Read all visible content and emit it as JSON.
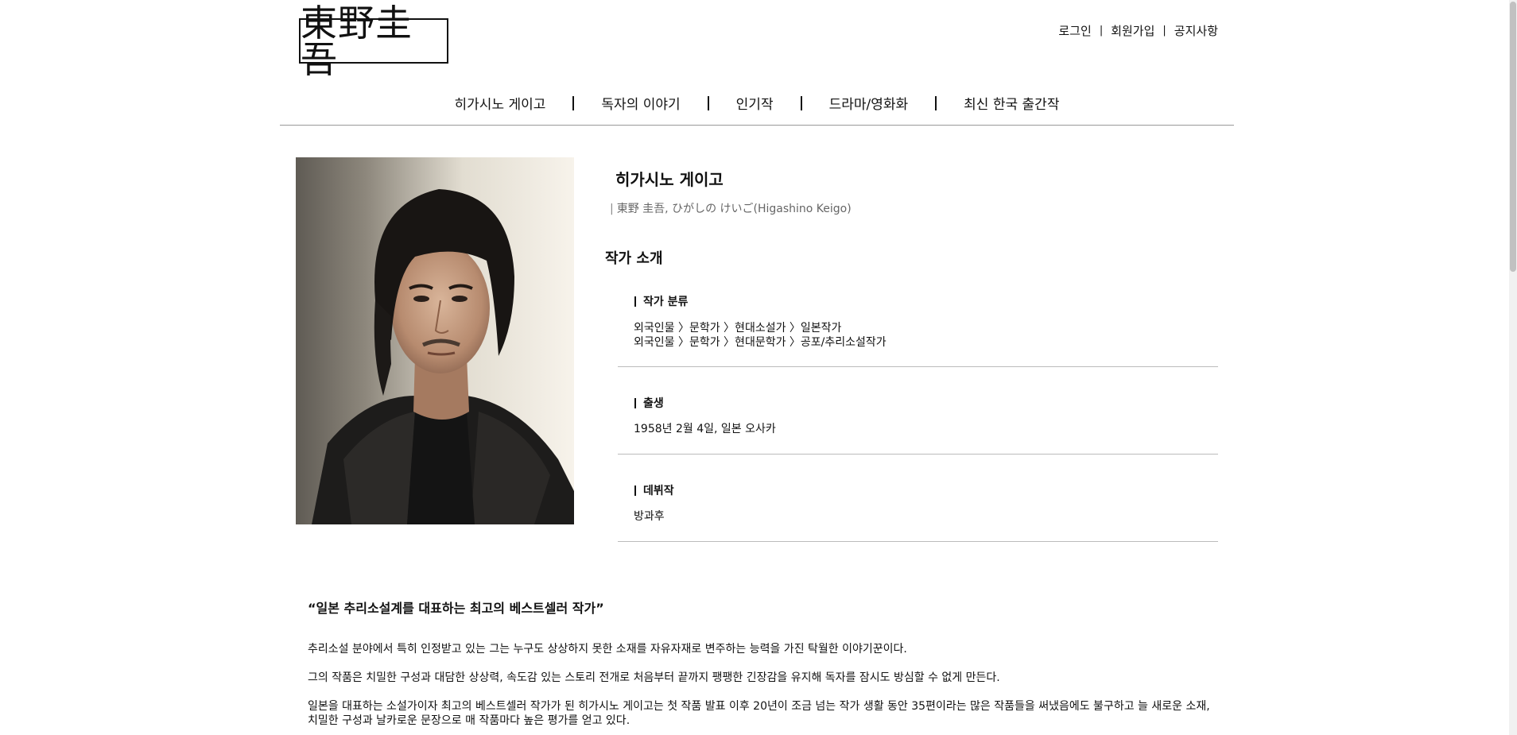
{
  "header": {
    "logo_text": "東野圭吾",
    "util_links": [
      "로그인",
      "회원가입",
      "공지사항"
    ],
    "nav": [
      "히가시노 게이고",
      "독자의 이야기",
      "인기작",
      "드라마/영화화",
      "최신 한국 출간작"
    ]
  },
  "profile": {
    "name": "히가시노 게이고",
    "subname": "東野 圭吾, ひがしの けいご(Higashino Keigo)",
    "intro_title": "작가 소개",
    "category": {
      "label": "작가 분류",
      "lines": [
        "외국인물 〉문학가 〉현대소설가 〉일본작가",
        "외국인물 〉문학가 〉현대문학가 〉공포/추리소설작가"
      ]
    },
    "birth": {
      "label": "출생",
      "value": "1958년 2월 4일, 일본 오사카"
    },
    "debut": {
      "label": "데뷔작",
      "value": "방과후"
    }
  },
  "body": {
    "quote": "“일본 추리소설계를 대표하는 최고의 베스트셀러 작가”",
    "paragraphs": [
      "추리소설 분야에서 특히 인정받고 있는 그는 누구도 상상하지 못한 소재를 자유자재로 변주하는 능력을 가진 탁월한 이야기꾼이다.",
      "그의 작품은 치밀한 구성과 대담한 상상력, 속도감 있는 스토리 전개로 처음부터 끝까지 팽팽한 긴장감을 유지해 독자를 잠시도 방심할 수 없게 만든다.",
      "일본을 대표하는 소설가이자 최고의 베스트셀러 작가가 된 히가시노 게이고는 첫 작품 발표 이후 20년이 조금 넘는 작가 생활 동안 35편이라는 많은 작품들을 써냈음에도 불구하고 늘 새로운 소재, 치밀한 구성과 날카로운 문장으로 매 작품마다 높은 평가를 얻고 있다."
    ]
  },
  "icons": {
    "photo": "author-portrait"
  }
}
